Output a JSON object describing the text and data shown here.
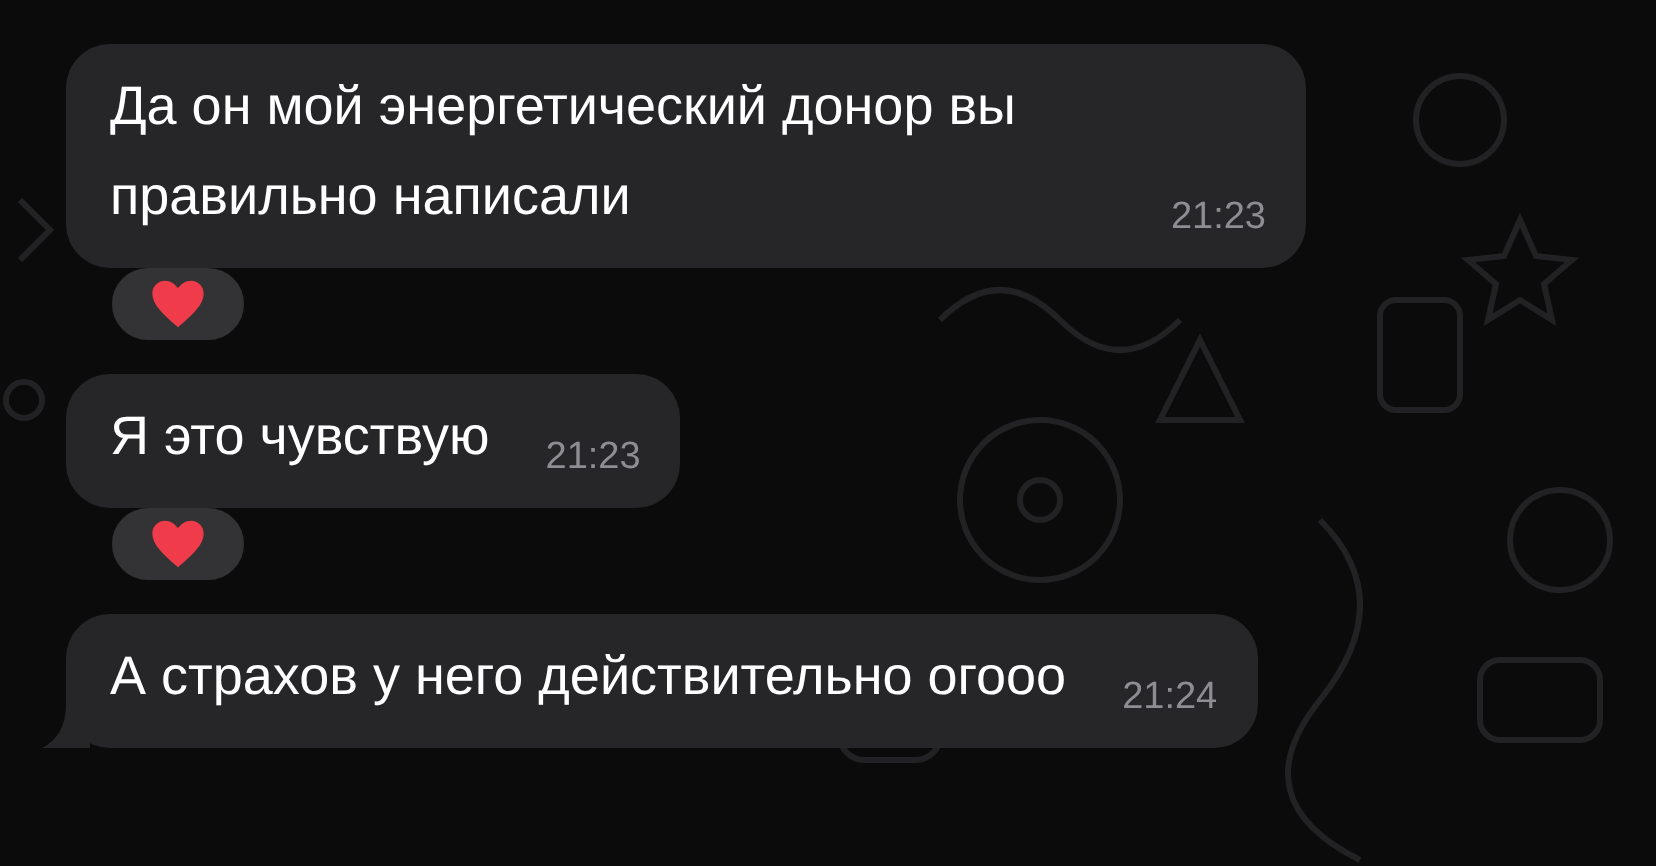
{
  "messages": [
    {
      "text": "Да он мой энергетический донор вы правильно написали",
      "time": "21:23",
      "reacted": true,
      "tail": false
    },
    {
      "text": "Я это чувствую",
      "time": "21:23",
      "reacted": true,
      "tail": false
    },
    {
      "text": "А страхов у него действительно огооо",
      "time": "21:24",
      "reacted": false,
      "tail": true
    }
  ]
}
